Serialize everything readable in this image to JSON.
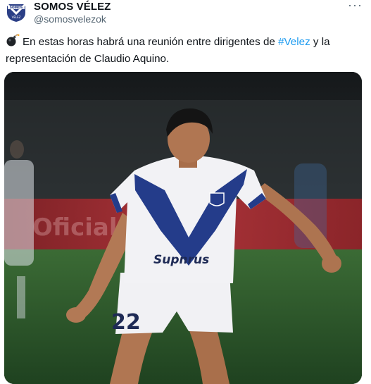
{
  "account": {
    "name": "SOMOS VÉLEZ",
    "handle": "@somosvelezok",
    "avatar_icon": "velez-crest-icon"
  },
  "menu": {
    "more_icon": "more-dots-icon",
    "label": "···"
  },
  "tweet": {
    "emoji_icon": "bomb-emoji-icon",
    "text_before": "En estas horas habrá una reunión entre dirigentes de ",
    "hashtag": "#Velez",
    "text_after": " y la representación de Claudio Aquino."
  },
  "photo": {
    "subject": "football-player-photo",
    "jersey_sponsor": "Supnrus",
    "jersey_number": "22",
    "board_text": "Oficial Tra...",
    "colors": {
      "jersey": "#f2f2f5",
      "stripe": "#243c8a",
      "pitch": "#2d5a2a",
      "board": "#b8262b"
    }
  }
}
